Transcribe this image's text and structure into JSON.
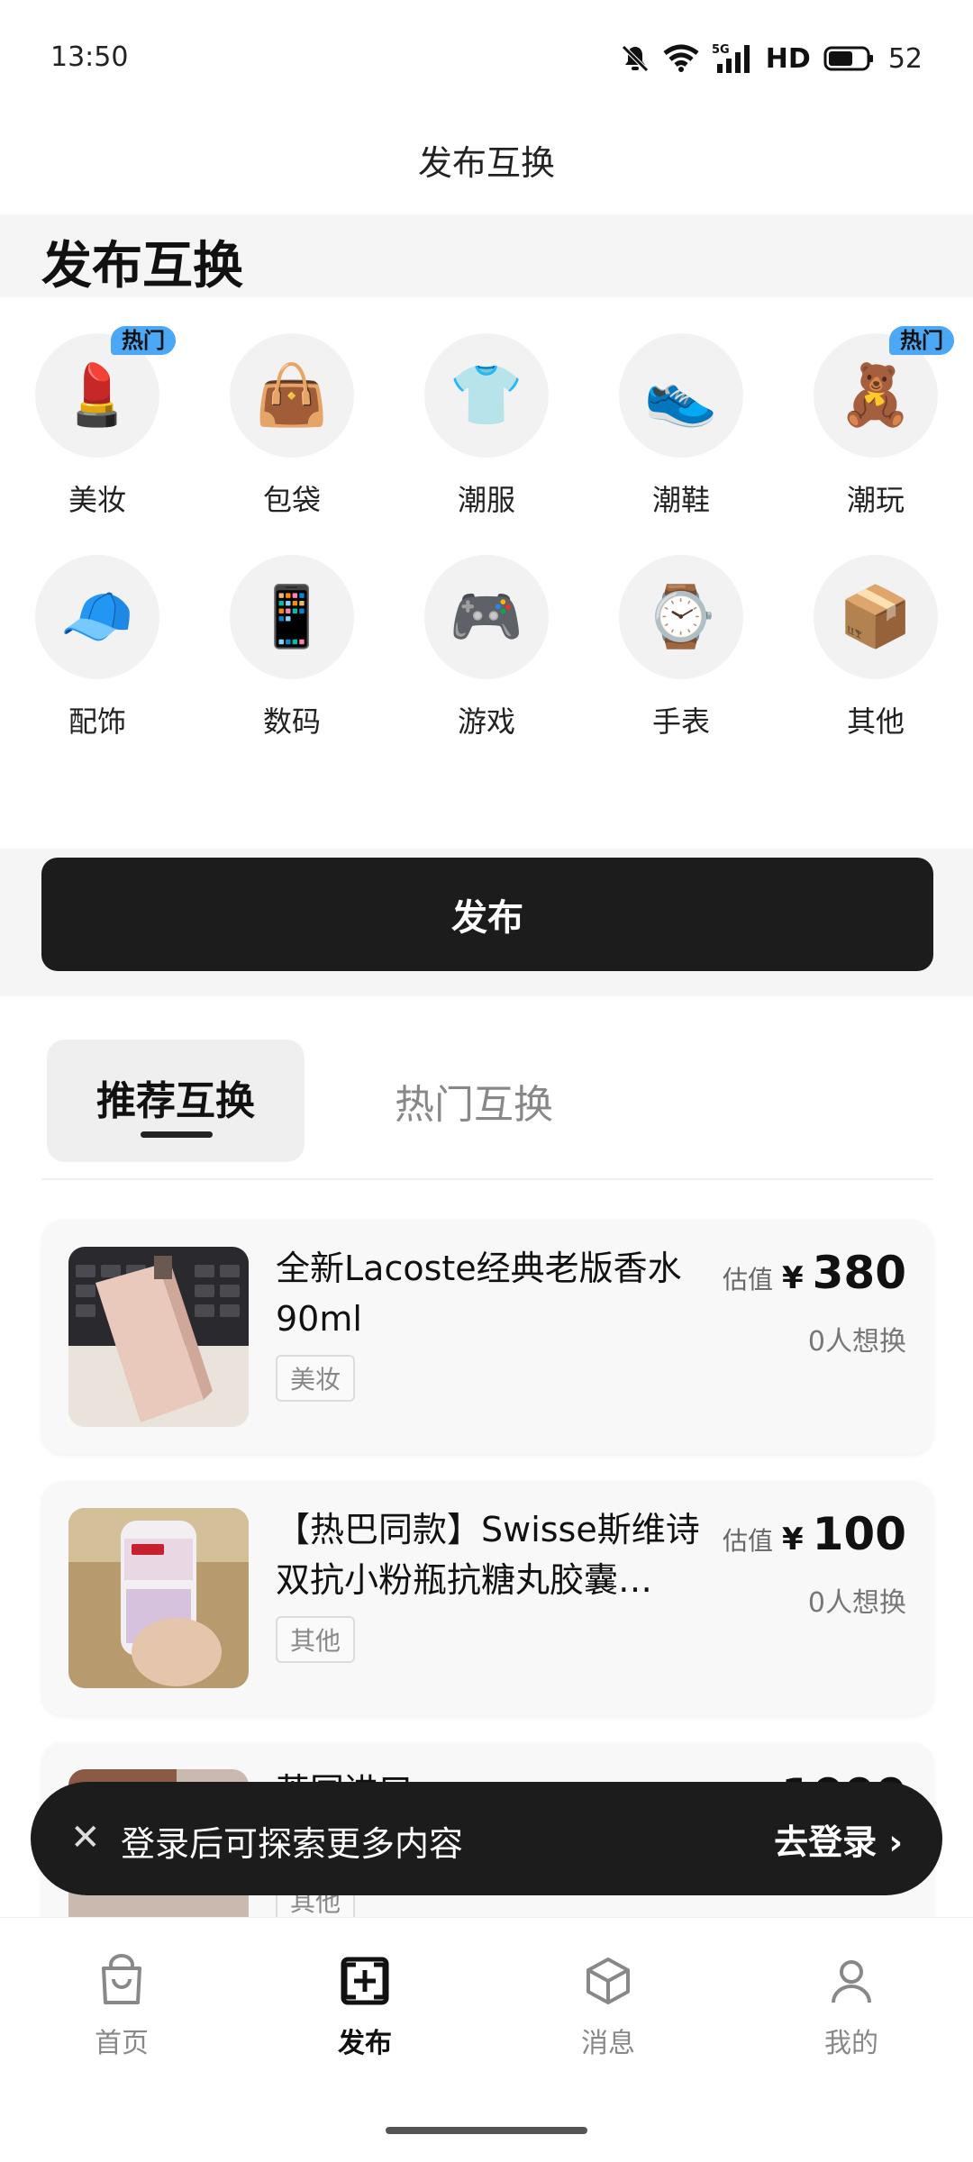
{
  "status_bar": {
    "time": "13:50",
    "network": "5G",
    "hd": "HD",
    "battery": "52"
  },
  "nav": {
    "title": "发布互换"
  },
  "section": {
    "title": "发布互换"
  },
  "categories": [
    {
      "label": "美妆",
      "icon": "lipstick-icon",
      "glyph": "💄",
      "hot": "热门"
    },
    {
      "label": "包袋",
      "icon": "handbag-icon",
      "glyph": "👜"
    },
    {
      "label": "潮服",
      "icon": "tshirt-icon",
      "glyph": "👕"
    },
    {
      "label": "潮鞋",
      "icon": "sneaker-icon",
      "glyph": "👟"
    },
    {
      "label": "潮玩",
      "icon": "teddy-bear-icon",
      "glyph": "🧸",
      "hot": "热门"
    },
    {
      "label": "配饰",
      "icon": "cap-icon",
      "glyph": "🧢"
    },
    {
      "label": "数码",
      "icon": "phone-icon",
      "glyph": "📱"
    },
    {
      "label": "游戏",
      "icon": "gamepad-icon",
      "glyph": "🎮"
    },
    {
      "label": "手表",
      "icon": "watch-icon",
      "glyph": "⌚"
    },
    {
      "label": "其他",
      "icon": "box-icon",
      "glyph": "📦"
    }
  ],
  "publish": {
    "label": "发布"
  },
  "tabs": {
    "active": "推荐互换",
    "inactive": "热门互换"
  },
  "items": [
    {
      "title": "全新Lacoste经典老版香水90ml",
      "tag": "美妆",
      "price_label": "估值",
      "currency": "¥",
      "price": "380",
      "want": "0人想换"
    },
    {
      "title": "【热巴同款】Swisse斯维诗双抗小粉瓶抗糖丸胶囊…",
      "tag": "其他",
      "price_label": "估值",
      "currency": "¥",
      "price": "100",
      "want": "0人想换"
    },
    {
      "title": "英国进口",
      "tag": "其他",
      "price_label": "",
      "currency": "¥",
      "price": "1000",
      "want": ""
    }
  ],
  "login_banner": {
    "close": "✕",
    "text": "登录后可探索更多内容",
    "action": "去登录 ›"
  },
  "tabbar": [
    {
      "label": "首页",
      "icon": "shopping-bag-icon"
    },
    {
      "label": "发布",
      "icon": "add-square-icon"
    },
    {
      "label": "消息",
      "icon": "cube-icon"
    },
    {
      "label": "我的",
      "icon": "user-icon"
    }
  ]
}
